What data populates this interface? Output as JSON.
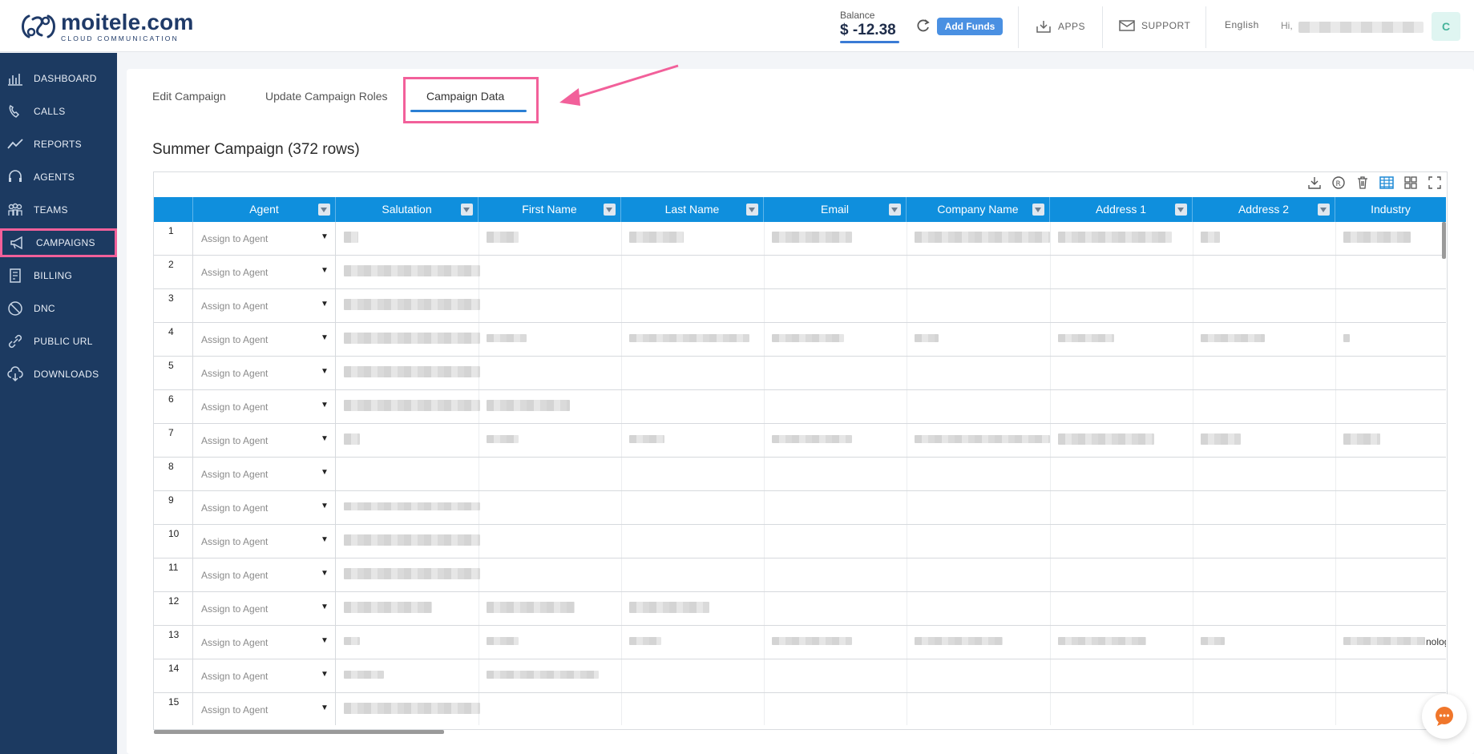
{
  "brand": {
    "name": "moitele.com",
    "tagline": "CLOUD COMMUNICATION"
  },
  "header": {
    "balance_label": "Balance",
    "balance_value": "$ -12.38",
    "add_funds_label": "Add Funds",
    "apps_label": "APPS",
    "support_label": "SUPPORT",
    "language": "English",
    "greeting": "Hi,",
    "avatar_initial": "C"
  },
  "sidebar": {
    "items": [
      {
        "label": "DASHBOARD",
        "icon": "dashboard-icon"
      },
      {
        "label": "CALLS",
        "icon": "phone-icon"
      },
      {
        "label": "REPORTS",
        "icon": "trend-icon"
      },
      {
        "label": "AGENTS",
        "icon": "headset-icon"
      },
      {
        "label": "TEAMS",
        "icon": "team-icon"
      },
      {
        "label": "CAMPAIGNS",
        "icon": "megaphone-icon",
        "active": true
      },
      {
        "label": "BILLING",
        "icon": "billing-icon"
      },
      {
        "label": "DNC",
        "icon": "block-icon"
      },
      {
        "label": "PUBLIC URL",
        "icon": "link-icon"
      },
      {
        "label": "DOWNLOADS",
        "icon": "cloud-download-icon"
      }
    ]
  },
  "tabs": [
    {
      "label": "Edit Campaign"
    },
    {
      "label": "Update Campaign Roles"
    },
    {
      "label": "Campaign Data",
      "active": true
    }
  ],
  "sheet": {
    "title": "Summer Campaign (372 rows)",
    "columns": [
      "Agent",
      "Salutation",
      "First Name",
      "Last Name",
      "Email",
      "Company Name",
      "Address 1",
      "Address 2",
      "Industry"
    ],
    "agent_placeholder": "Assign to Agent",
    "row_numbers": [
      "1",
      "2",
      "3",
      "4",
      "5",
      "6",
      "7",
      "8",
      "9",
      "10",
      "11",
      "12",
      "13",
      "14",
      "15"
    ],
    "industry_tail_row13": "nolog"
  },
  "colors": {
    "sidebar_bg": "#1c3a61",
    "header_bg": "#0f8fdd",
    "highlight": "#f2609a",
    "accent": "#2b7fd4"
  }
}
